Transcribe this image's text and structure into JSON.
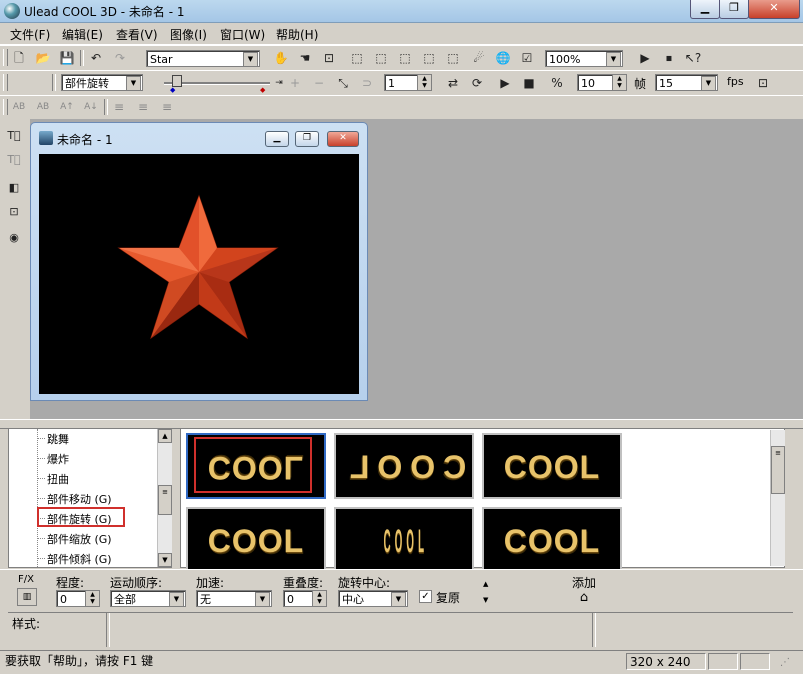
{
  "window": {
    "title": "Ulead COOL 3D - 未命名 - 1"
  },
  "menu": [
    "文件(F)",
    "编辑(E)",
    "查看(V)",
    "图像(I)",
    "窗口(W)",
    "帮助(H)"
  ],
  "toolbar1": {
    "object_combo": "Star",
    "zoom_combo": "100%"
  },
  "toolbar2": {
    "effect_combo": "部件旋转",
    "frame_value": "1",
    "frame_count": "10",
    "frame_label": "帧",
    "fps_value": "15",
    "fps_label": "fps"
  },
  "child_window": {
    "title": "未命名 - 1"
  },
  "effect_tree": {
    "items": [
      "跳舞",
      "爆炸",
      "扭曲",
      "部件移动 (G)",
      "部件旋转 (G)",
      "部件缩放 (G)",
      "部件倾斜 (G)"
    ],
    "selected_index": 4
  },
  "thumbnails": [
    {
      "text": "COOL",
      "variant": "mirror-flip"
    },
    {
      "text": "COOL",
      "variant": "rotated-letters"
    },
    {
      "text": "COOL",
      "variant": "normal"
    },
    {
      "text": "COOL",
      "variant": "normal"
    },
    {
      "text": "COOL",
      "variant": "edge-on"
    },
    {
      "text": "COOL",
      "variant": "normal"
    }
  ],
  "attributes": {
    "fx_label": "F/X",
    "degree_label": "程度:",
    "degree_value": "0",
    "order_label": "运动顺序:",
    "order_value": "全部",
    "accel_label": "加速:",
    "accel_value": "无",
    "overlap_label": "重叠度:",
    "overlap_value": "0",
    "center_label": "旋转中心:",
    "center_value": "中心",
    "restore_label": "复原",
    "restore_checked": true,
    "add_label": "添加"
  },
  "style_label": "样式:",
  "status": {
    "message": "要获取「帮助」，请按 F1 键",
    "size": "320 x 240"
  },
  "colors": {
    "star": "#e2512a",
    "cool_text": "#e8c36a",
    "highlight_box": "#d0302c"
  }
}
